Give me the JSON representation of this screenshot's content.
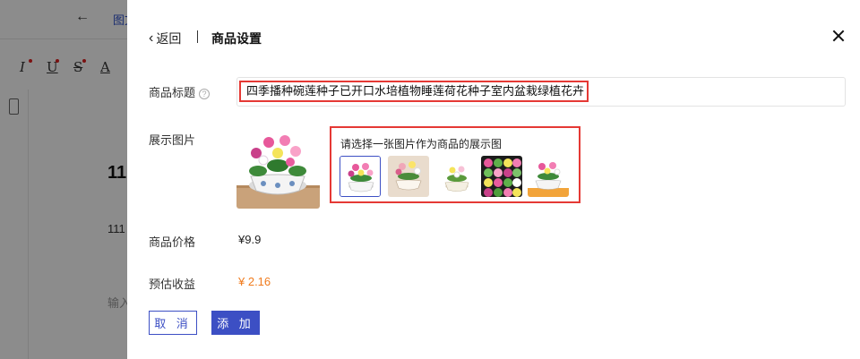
{
  "background_editor": {
    "back_arrow": "←",
    "tab_text": "图文",
    "toolbar": [
      "I",
      "U",
      "S",
      "A"
    ],
    "heading": "11",
    "line": "111",
    "placeholder": "输入"
  },
  "modal": {
    "back_label": "返回",
    "title": "商品设置",
    "fields": {
      "product_title": {
        "label": "商品标题",
        "value": "四季播种碗莲种子已开口水培植物睡莲荷花种子室内盆栽绿植花卉"
      },
      "display_image": {
        "label": "展示图片",
        "picker_prompt": "请选择一张图片作为商品的展示图",
        "thumbnails": [
          {
            "name": "lotus-bowl-white",
            "selected": true
          },
          {
            "name": "lotus-bowl-mixed",
            "selected": false
          },
          {
            "name": "lotus-bowl-small",
            "selected": false
          },
          {
            "name": "lotus-seed-grid",
            "selected": false
          },
          {
            "name": "lotus-bowl-promo",
            "selected": false
          }
        ]
      },
      "price": {
        "label": "商品价格",
        "value": "¥9.9"
      },
      "earnings": {
        "label": "预估收益",
        "value": "¥ 2.16"
      }
    },
    "buttons": {
      "cancel": "取 消",
      "add": "添 加"
    }
  },
  "colors": {
    "accent": "#3c4fc4",
    "highlight_red": "#e53935",
    "earnings_orange": "#f07b1d"
  }
}
